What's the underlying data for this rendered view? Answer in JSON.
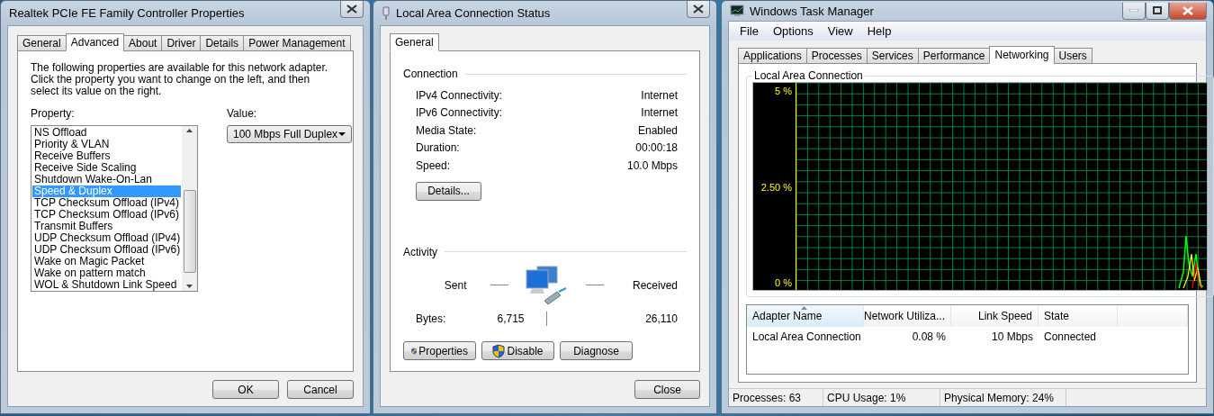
{
  "properties_dialog": {
    "title": "Realtek PCIe FE Family Controller Properties",
    "tabs": [
      {
        "label": "General",
        "selected": false
      },
      {
        "label": "Advanced",
        "selected": true
      },
      {
        "label": "About",
        "selected": false
      },
      {
        "label": "Driver",
        "selected": false
      },
      {
        "label": "Details",
        "selected": false
      },
      {
        "label": "Power Management",
        "selected": false
      }
    ],
    "description": "The following properties are available for this network adapter. Click the property you want to change on the left, and then select its value on the right.",
    "property_label": "Property:",
    "value_label": "Value:",
    "properties": [
      {
        "label": "NS Offload",
        "selected": false
      },
      {
        "label": "Priority & VLAN",
        "selected": false
      },
      {
        "label": "Receive Buffers",
        "selected": false
      },
      {
        "label": "Receive Side Scaling",
        "selected": false
      },
      {
        "label": "Shutdown Wake-On-Lan",
        "selected": false
      },
      {
        "label": "Speed & Duplex",
        "selected": true
      },
      {
        "label": "TCP Checksum Offload (IPv4)",
        "selected": false
      },
      {
        "label": "TCP Checksum Offload (IPv6)",
        "selected": false
      },
      {
        "label": "Transmit Buffers",
        "selected": false
      },
      {
        "label": "UDP Checksum Offload (IPv4)",
        "selected": false
      },
      {
        "label": "UDP Checksum Offload (IPv6)",
        "selected": false
      },
      {
        "label": "Wake on Magic Packet",
        "selected": false
      },
      {
        "label": "Wake on pattern match",
        "selected": false
      },
      {
        "label": "WOL & Shutdown Link Speed",
        "selected": false
      }
    ],
    "value": "100 Mbps Full Duplex",
    "buttons": [
      "OK",
      "Cancel"
    ]
  },
  "status_dialog": {
    "title": "Local Area Connection Status",
    "tabs": [
      {
        "label": "General",
        "selected": true
      }
    ],
    "connection_heading": "Connection",
    "connection_rows": [
      {
        "label": "IPv4 Connectivity:",
        "value": "Internet"
      },
      {
        "label": "IPv6 Connectivity:",
        "value": "Internet"
      },
      {
        "label": "Media State:",
        "value": "Enabled"
      },
      {
        "label": "Duration:",
        "value": "00:00:18"
      },
      {
        "label": "Speed:",
        "value": "10.0 Mbps"
      }
    ],
    "details_button": "Details...",
    "activity_heading": "Activity",
    "sent_label": "Sent",
    "received_label": "Received",
    "bytes_label": "Bytes:",
    "bytes_sent": "6,715",
    "bytes_received": "26,110",
    "buttons": [
      {
        "label": "Properties",
        "kind": "shield"
      },
      {
        "label": "Disable",
        "kind": "shield"
      },
      {
        "label": "Diagnose",
        "kind": "plain"
      }
    ],
    "close_button": "Close"
  },
  "task_manager": {
    "title": "Windows Task Manager",
    "menu": [
      "File",
      "Options",
      "View",
      "Help"
    ],
    "tabs": [
      {
        "label": "Applications",
        "selected": false
      },
      {
        "label": "Processes",
        "selected": false
      },
      {
        "label": "Services",
        "selected": false
      },
      {
        "label": "Performance",
        "selected": false
      },
      {
        "label": "Networking",
        "selected": true
      },
      {
        "label": "Users",
        "selected": false
      }
    ],
    "graph_title": "Local Area Connection",
    "graph_axis": [
      "5 %",
      "2.50 %",
      "0 %"
    ],
    "columns": [
      {
        "label": "Adapter Name",
        "sorted": true
      },
      {
        "label": "Network Utiliza...",
        "sorted": false
      },
      {
        "label": "Link Speed",
        "sorted": false
      },
      {
        "label": "State",
        "sorted": false
      }
    ],
    "rows": [
      [
        "Local Area Connection",
        "0.08 %",
        "10 Mbps",
        "Connected"
      ]
    ],
    "status_bar": [
      "Processes: 63",
      "CPU Usage: 1%",
      "Physical Memory: 24%"
    ]
  }
}
